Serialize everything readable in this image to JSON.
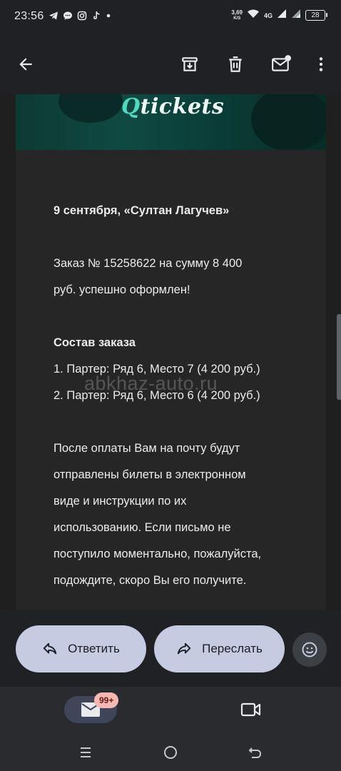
{
  "status_bar": {
    "time": "23:56",
    "speed_value": "3,69",
    "speed_unit": "K/S",
    "network": "4G",
    "battery": "28",
    "notification_icons": [
      "telegram-icon",
      "chat-icon",
      "instagram-icon",
      "tiktok-icon",
      "dot-icon"
    ]
  },
  "top_bar": {
    "icons": [
      "back-arrow-icon",
      "archive-icon",
      "delete-icon",
      "mark-unread-icon",
      "more-vert-icon"
    ]
  },
  "email": {
    "logo_q": "Q",
    "logo_rest": "tickets",
    "lines": [
      {
        "text": "9 сентября, «Султан Лагучев»",
        "bold": true
      },
      {
        "text": "Заказ № 15258622 на сумму 8 400",
        "bold": false
      },
      {
        "text": "руб. успешно оформлен!",
        "bold": false
      },
      {
        "text": "Состав заказа",
        "bold": true
      },
      {
        "text": "1. Партер: Ряд 6, Место 7 (4 200 руб.)",
        "bold": false
      },
      {
        "text": "2. Партер: Ряд 6, Место 6 (4 200 руб.)",
        "bold": false
      },
      {
        "text": "После оплаты Вам на почту будут",
        "bold": false
      },
      {
        "text": "отправлены билеты в электронном",
        "bold": false
      },
      {
        "text": "виде и инструкции по их",
        "bold": false
      },
      {
        "text": "использованию. Если письмо не",
        "bold": false
      },
      {
        "text": "поступило моментально, пожалуйста,",
        "bold": false
      },
      {
        "text": "подождите, скоро Вы его получите.",
        "bold": false
      }
    ]
  },
  "watermark": "abkhaz-auto.ru",
  "actions": {
    "reply_label": "Ответить",
    "forward_label": "Переслать"
  },
  "bottom_nav": {
    "mail_badge": "99+"
  },
  "colors": {
    "background": "#202124",
    "email_body": "#262626",
    "button_bg": "#c5cbe1",
    "brand_teal": "#4fd9bf",
    "badge_bg": "#f6b8b0"
  }
}
